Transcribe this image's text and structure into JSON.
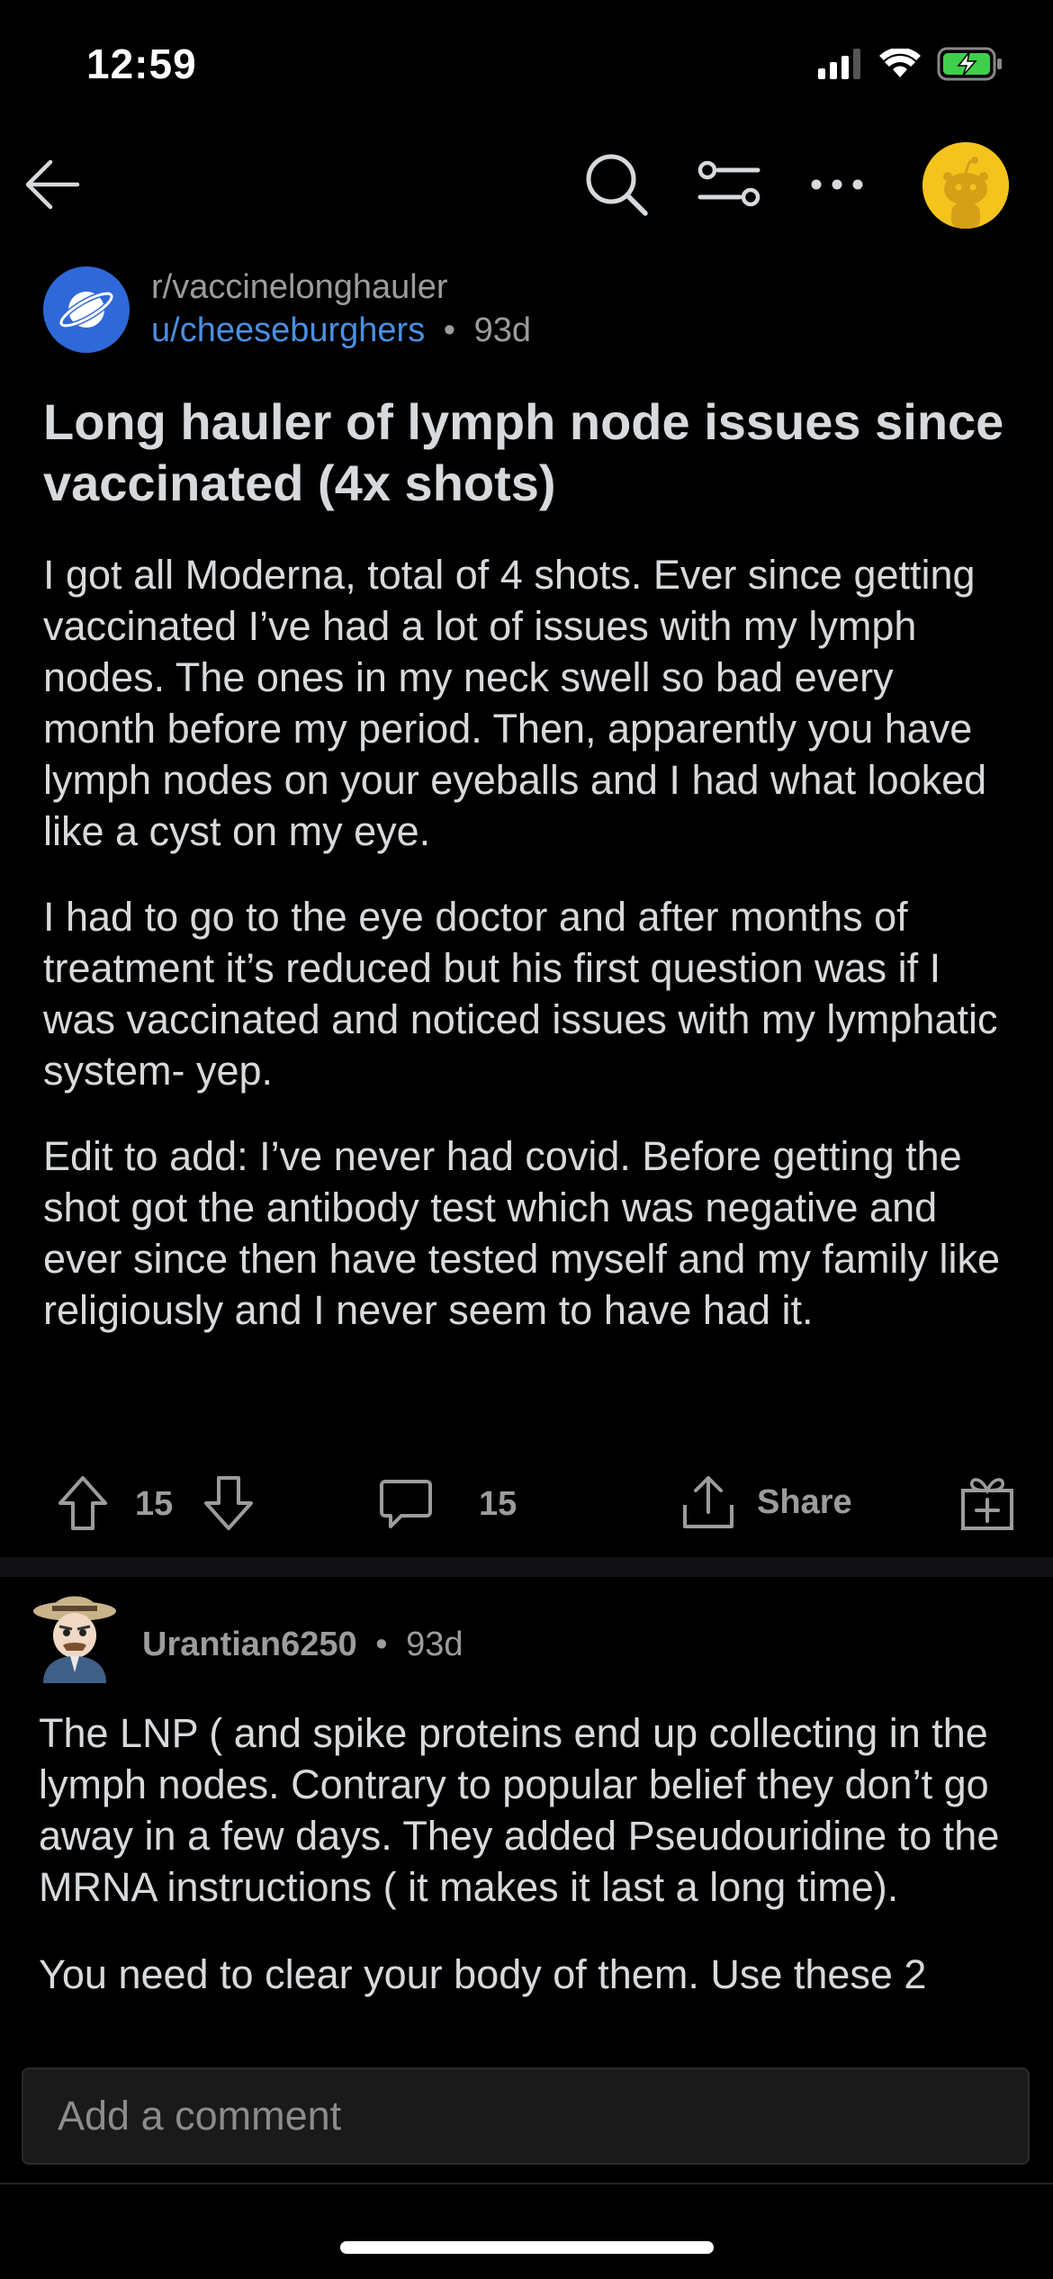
{
  "status_bar": {
    "time": "12:59",
    "icons": [
      "signal-icon",
      "wifi-icon",
      "battery-charging-icon"
    ]
  },
  "header": {
    "icons": [
      "back-arrow-icon",
      "search-icon",
      "sort-icon",
      "more-icon",
      "snoo-avatar-icon"
    ]
  },
  "post": {
    "subreddit": "r/vaccinelonghauler",
    "author": "u/cheeseburghers",
    "separator": "•",
    "age": "93d",
    "title": "Long hauler of lymph node issues since vaccinated (4x shots)",
    "paragraphs": [
      "I got all Moderna, total of 4 shots. Ever since getting vaccinated I’ve had a lot of issues with my lymph nodes. The ones in my neck swell so bad every month before my period. Then, apparently you have lymph nodes on your eyeballs and I had what looked like a cyst on my eye.",
      "I had to go to the eye doctor and after months of treatment it’s reduced but his first question was if I was vaccinated and noticed issues with my lymphatic system- yep.",
      "Edit to add: I’ve never had covid. Before getting the shot got the antibody test which was negative and ever since then have tested myself and my family like religiously and I never seem to have had it."
    ],
    "votes": "15",
    "comments": "15",
    "share_label": "Share"
  },
  "comment": {
    "author": "Urantian6250",
    "separator": "•",
    "age": "93d",
    "paragraphs": [
      "The LNP ( and spike proteins end up collecting in the lymph nodes. Contrary to popular belief they don’t go  away in a few days. They added Pseudouridine to the MRNA instructions ( it makes it last a long time).",
      "You need to clear your body of them. Use these 2"
    ]
  },
  "composer": {
    "placeholder": "Add a comment"
  },
  "colors": {
    "background": "#000000",
    "text": "#d7dadc",
    "muted": "#9a9c9e",
    "link": "#4a90e2",
    "subreddit_icon": "#2f68d8",
    "avatar_bg": "#f4c41c"
  }
}
